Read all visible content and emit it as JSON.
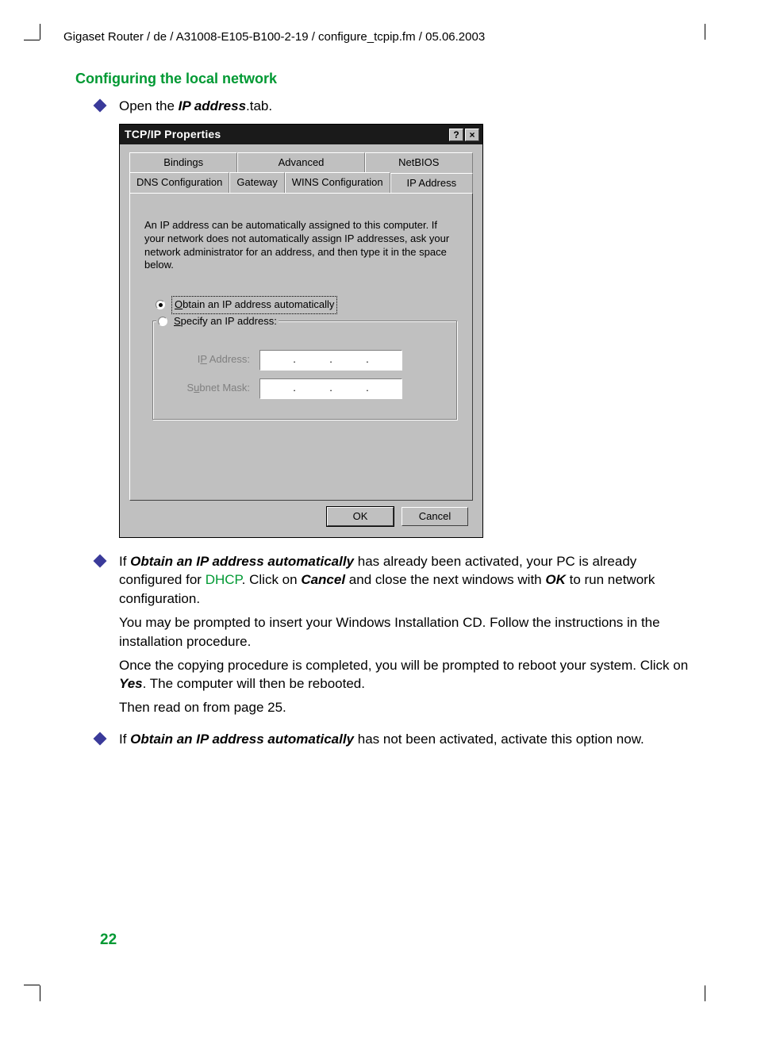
{
  "header_path": "Gigaset Router / de / A31008-E105-B100-2-19 / configure_tcpip.fm / 05.06.2003",
  "section_title": "Configuring the local network",
  "bullets": {
    "b1_prefix": "Open the ",
    "b1_bold": "IP address",
    "b1_suffix": ".tab.",
    "b2_prefix": "If ",
    "b2_bold": "Obtain an IP address automatically",
    "b2_mid1": " has already been activated, your PC is already configured for ",
    "b2_link": "DHCP",
    "b2_mid2": ". Click on ",
    "b2_bold2": "Cancel",
    "b2_mid3": " and close the next windows with ",
    "b2_bold3": "OK",
    "b2_suffix": " to run network configuration.",
    "p3": "You may be prompted to insert your Windows Installation CD. Follow the instructions in the installation procedure.",
    "p4a": "Once the copying procedure is completed, you will be prompted to reboot your system. Click on ",
    "p4_bold": "Yes",
    "p4b": ". The computer will then be rebooted.",
    "p5": "Then read on from page 25.",
    "b3_prefix": "If ",
    "b3_bold": "Obtain an IP address automatically",
    "b3_suffix": " has not been activated, activate this option now."
  },
  "dialog": {
    "title": "TCP/IP Properties",
    "help_btn": "?",
    "close_btn": "×",
    "tabs_row1": [
      "Bindings",
      "Advanced",
      "NetBIOS"
    ],
    "tabs_row2": [
      "DNS Configuration",
      "Gateway",
      "WINS Configuration",
      "IP Address"
    ],
    "active_tab": "IP Address",
    "description": "An IP address can be automatically assigned to this computer. If your network does not automatically assign IP addresses, ask your network administrator for an address, and then type it in the space below.",
    "radio_auto_pre": "O",
    "radio_auto_rest": "btain an IP address automatically",
    "radio_specify_pre": "S",
    "radio_specify_rest": "pecify an IP address:",
    "field_ip_pre": "I",
    "field_ip_mid": "P",
    "field_ip_rest": " Address:",
    "field_subnet_pre": "S",
    "field_subnet_mid": "u",
    "field_subnet_rest": "bnet Mask:",
    "ok": "OK",
    "cancel": "Cancel"
  },
  "page_number": "22"
}
